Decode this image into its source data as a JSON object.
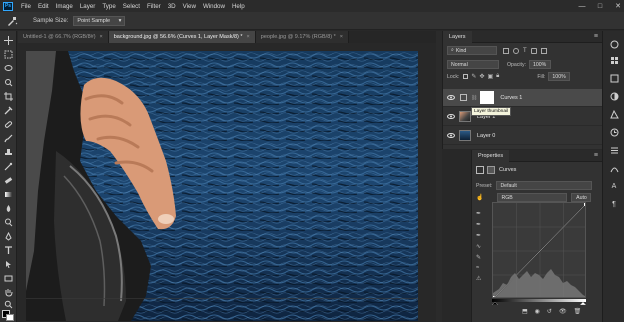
{
  "menubar": {
    "logo": "Ps",
    "items": [
      "File",
      "Edit",
      "Image",
      "Layer",
      "Type",
      "Select",
      "Filter",
      "3D",
      "View",
      "Window",
      "Help"
    ],
    "win_min": "—",
    "win_max": "□",
    "win_close": "✕"
  },
  "options": {
    "sample_size_label": "Sample Size:",
    "sample_size_value": "Point Sample"
  },
  "tabs": [
    {
      "label": "Untitled-1 @ 66.7% (RGB/8#)",
      "close": "×"
    },
    {
      "label": "background.jpg @ 56.6% (Curves 1, Layer Mask/8) *",
      "close": "×"
    },
    {
      "label": "people.jpg @ 9.17% (RGB/8) *",
      "close": "×"
    }
  ],
  "layers": {
    "title": "Layers",
    "filter_kind": "Kind",
    "blend_mode": "Normal",
    "opacity_label": "Opacity:",
    "opacity_value": "100%",
    "lock_label": "Lock:",
    "fill_label": "Fill:",
    "fill_value": "100%",
    "items": [
      {
        "name": "Curves 1"
      },
      {
        "name": "Layer 1"
      },
      {
        "name": "Layer 0"
      }
    ],
    "tooltip": "Layer thumbnail"
  },
  "properties": {
    "title": "Properties",
    "adjustment_name": "Curves",
    "preset_label": "Preset:",
    "preset_value": "Default",
    "channel_value": "RGB",
    "auto_label": "Auto"
  },
  "colors": {
    "accent": "#31a8ff",
    "water_dark": "#0d2035",
    "water_light": "#2c5a86"
  }
}
